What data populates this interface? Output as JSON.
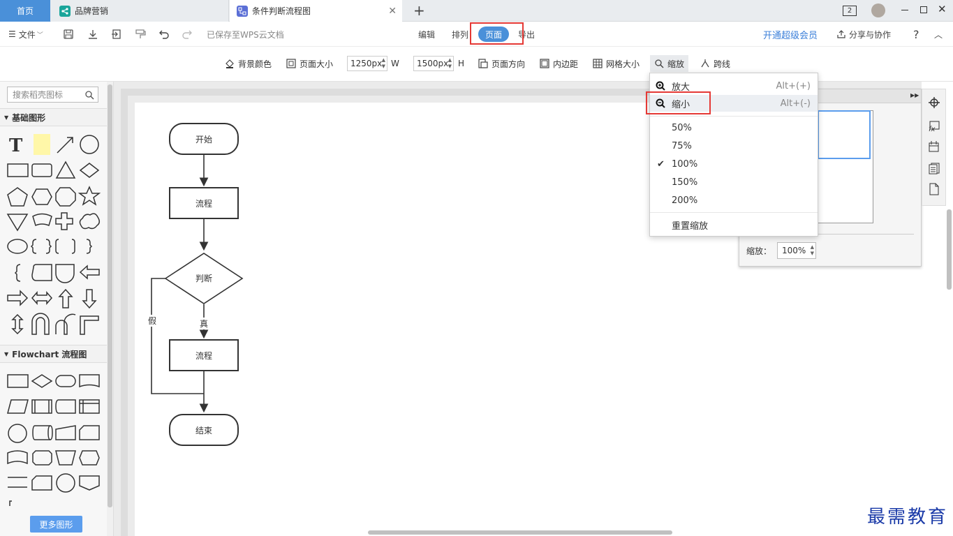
{
  "tabs": {
    "home": "首页",
    "brand": "品牌营销",
    "active": "条件判断流程图",
    "new_tab": "+"
  },
  "titlebar": {
    "badge": "2"
  },
  "menubar": {
    "file": "文件",
    "saved_status": "已保存至WPS云文档",
    "edit": "编辑",
    "arrange": "排列",
    "page": "页面",
    "export": "导出",
    "vip": "开通超级会员",
    "share": "分享与协作",
    "help": "?"
  },
  "toolbar": {
    "bg_color": "背景颜色",
    "page_size": "页面大小",
    "width_value": "1250px",
    "width_unit": "W",
    "height_value": "1500px",
    "height_unit": "H",
    "orientation": "页面方向",
    "margin": "内边距",
    "grid_size": "网格大小",
    "zoom": "缩放",
    "cross_line": "跨线"
  },
  "left_panel": {
    "search_placeholder": "搜索稻壳图标",
    "section_basic": "基础图形",
    "section_flowchart": "Flowchart 流程图",
    "more_shapes": "更多图形"
  },
  "flowchart": {
    "start": "开始",
    "process1": "流程",
    "decision": "判断",
    "false_label": "假",
    "true_label": "真",
    "process2": "流程",
    "end": "结束"
  },
  "zoom_menu": {
    "zoom_in": "放大",
    "zoom_in_shortcut": "Alt+(+)",
    "zoom_out": "缩小",
    "zoom_out_shortcut": "Alt+(-)",
    "options": [
      "50%",
      "75%",
      "100%",
      "150%",
      "200%"
    ],
    "checked": "100%",
    "reset": "重置缩放"
  },
  "nav_panel": {
    "zoom_label": "缩放：",
    "zoom_value": "100%"
  },
  "watermark": "最需教育",
  "colors": {
    "accent": "#4a90d9",
    "highlight_box": "#e53935",
    "vip_text": "#3b7fd9"
  }
}
